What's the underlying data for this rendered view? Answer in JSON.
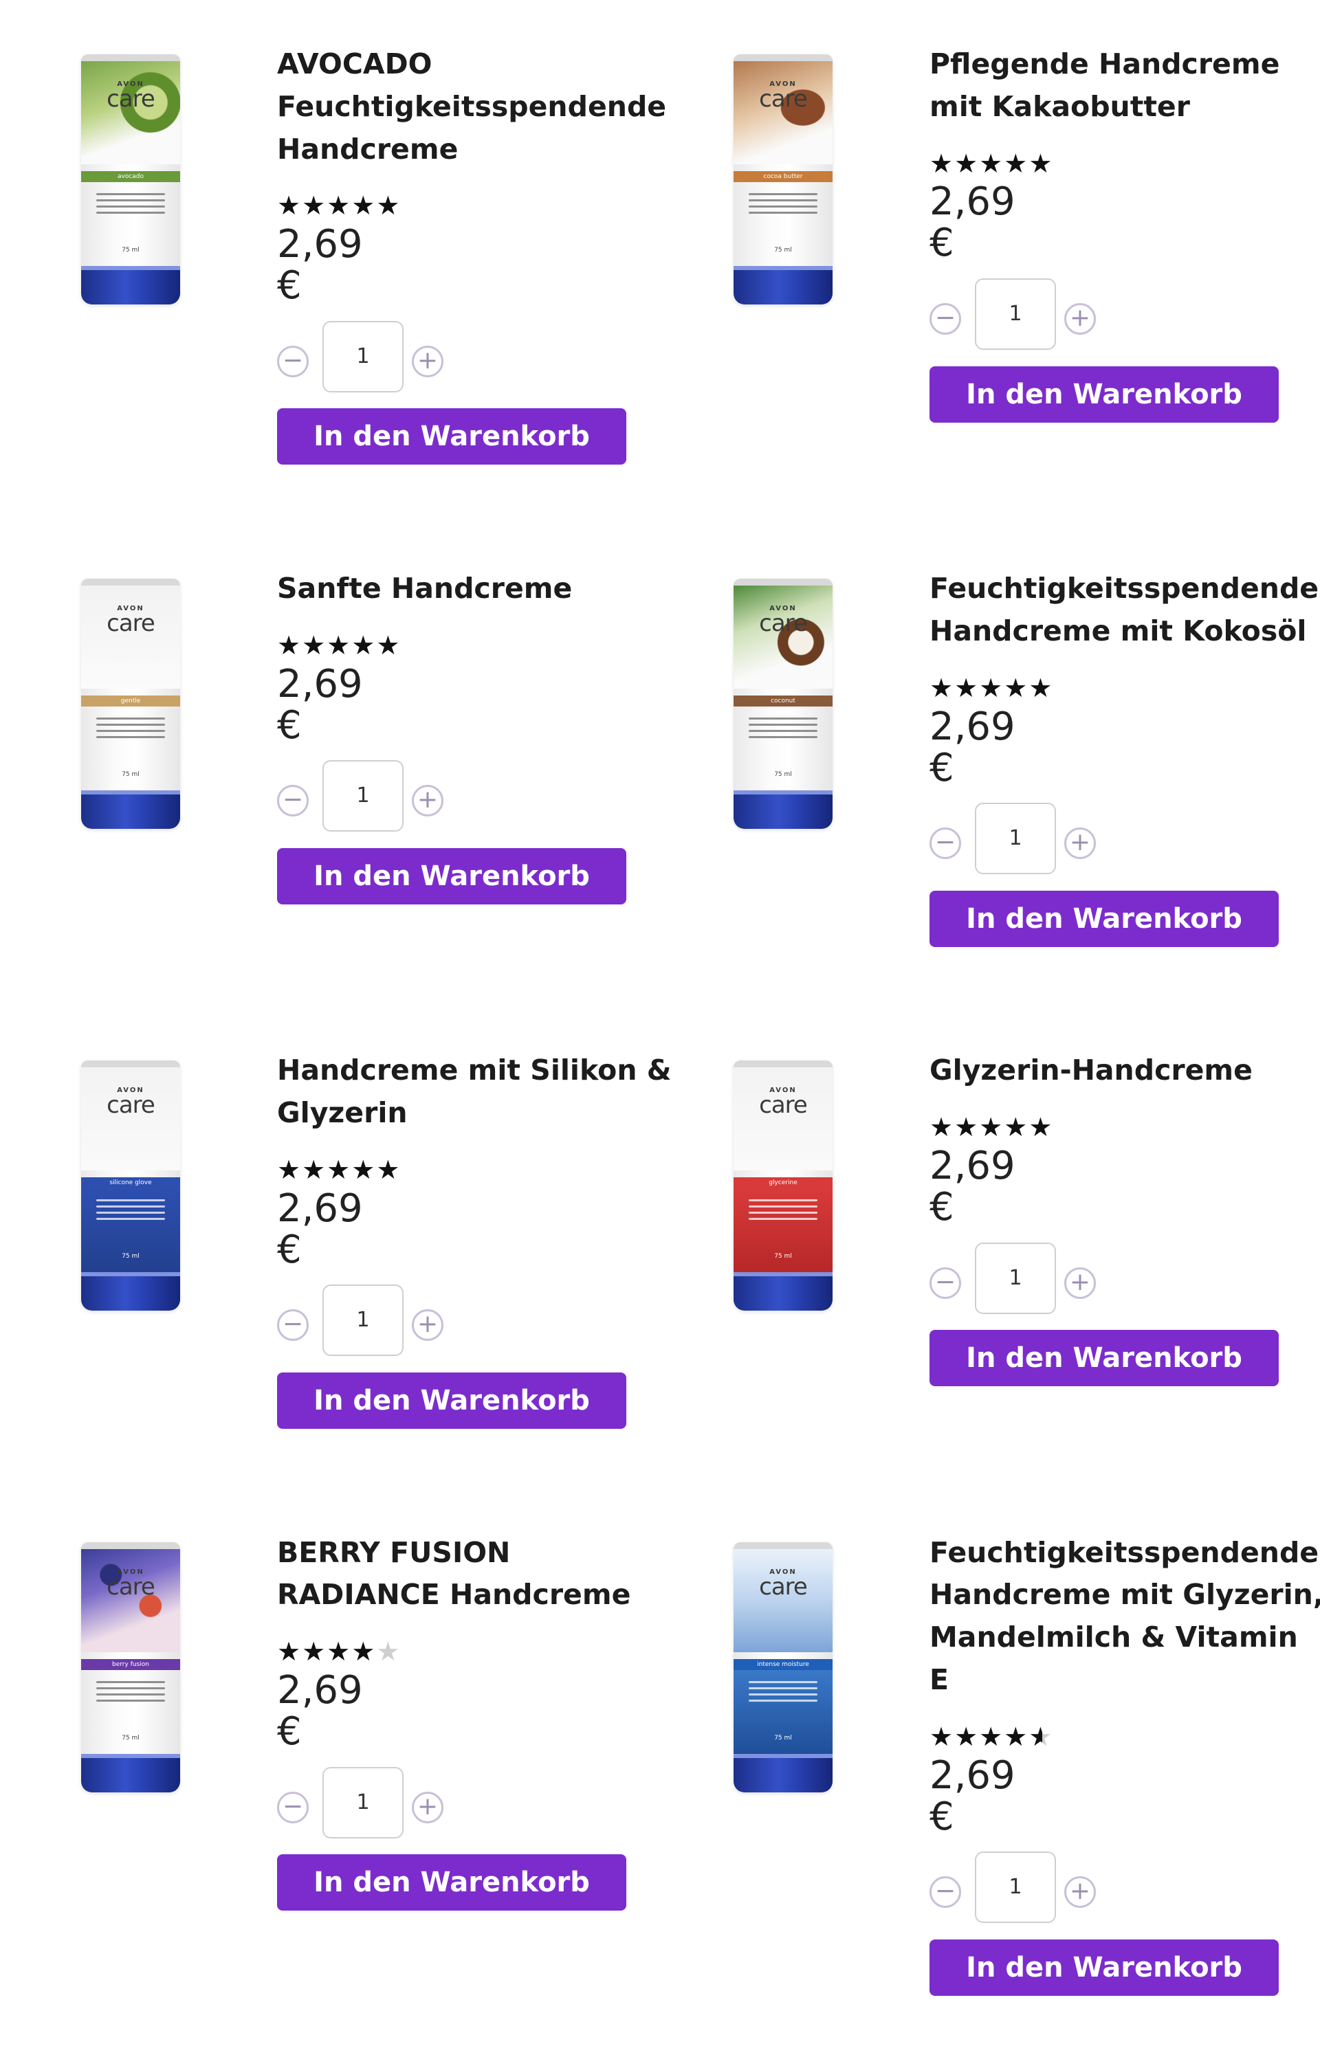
{
  "products": [
    {
      "title_lines": [
        "AVOCADO",
        "Feuchtigkeitsspendende",
        "Handcreme"
      ],
      "rating": 5,
      "price": "2,69 €",
      "quantity": "1",
      "button_label": "In den Warenkorb",
      "tube": {
        "avon": "AVON",
        "care": "care",
        "variant": "avocado",
        "ml": "75 ml",
        "accent": "#6b9a3a",
        "art": "avocado"
      }
    },
    {
      "title_lines": [
        "Pflegende Handcreme",
        "mit Kakaobutter"
      ],
      "rating": 5,
      "price": "2,69 €",
      "quantity": "1",
      "button_label": "In den Warenkorb",
      "tube": {
        "avon": "AVON",
        "care": "care",
        "variant": "cocoa butter",
        "ml": "75 ml",
        "accent": "#c77c3a",
        "art": "cocoa"
      }
    },
    {
      "title_lines": [
        "Sanfte Handcreme"
      ],
      "rating": 5,
      "price": "2,69 €",
      "quantity": "1",
      "button_label": "In den Warenkorb",
      "tube": {
        "avon": "AVON",
        "care": "care",
        "variant": "gentle",
        "ml": "75 ml",
        "accent": "#c9a266",
        "art": "plain"
      }
    },
    {
      "title_lines": [
        "Feuchtigkeitsspendende",
        "Handcreme mit Kokosöl"
      ],
      "rating": 5,
      "price": "2,69 €",
      "quantity": "1",
      "button_label": "In den Warenkorb",
      "tube": {
        "avon": "AVON",
        "care": "care",
        "variant": "coconut",
        "ml": "75 ml",
        "accent": "#8a5a3a",
        "art": "coconut"
      }
    },
    {
      "title_lines": [
        "Handcreme mit Silikon &",
        "Glyzerin"
      ],
      "rating": 5,
      "price": "2,69 €",
      "quantity": "1",
      "button_label": "In den Warenkorb",
      "tube": {
        "avon": "AVON",
        "care": "care",
        "variant": "silicone glove",
        "ml": "75 ml",
        "accent": "#2d4fb0",
        "art": "blue"
      }
    },
    {
      "title_lines": [
        "Glyzerin-Handcreme"
      ],
      "rating": 5,
      "price": "2,69 €",
      "quantity": "1",
      "button_label": "In den Warenkorb",
      "tube": {
        "avon": "AVON",
        "care": "care",
        "variant": "glycerine",
        "ml": "75 ml",
        "accent": "#d83a3a",
        "art": "red"
      }
    },
    {
      "title_lines": [
        "BERRY FUSION",
        "RADIANCE Handcreme"
      ],
      "rating": 4,
      "price": "2,69 €",
      "quantity": "1",
      "button_label": "In den Warenkorb",
      "tube": {
        "avon": "AVON",
        "care": "care",
        "variant": "berry fusion",
        "ml": "75 ml",
        "accent": "#6a3aa8",
        "art": "berry"
      }
    },
    {
      "title_lines": [
        "Feuchtigkeitsspendende",
        "Handcreme mit Glyzerin,",
        "Mandelmilch & Vitamin",
        "E"
      ],
      "rating": 4.5,
      "price": "2,69 €",
      "quantity": "1",
      "button_label": "In den Warenkorb",
      "tube": {
        "avon": "AVON",
        "care": "care",
        "variant": "intense moisture",
        "ml": "75 ml",
        "accent": "#1f5fb8",
        "art": "deepblue"
      }
    }
  ],
  "icons": {
    "minus": "minus-circle-icon",
    "plus": "plus-circle-icon",
    "star": "star-icon"
  },
  "colors": {
    "button": "#7c2ccc",
    "stepper_border": "#c9c0d8",
    "cap_blue": "#2a44b8"
  }
}
